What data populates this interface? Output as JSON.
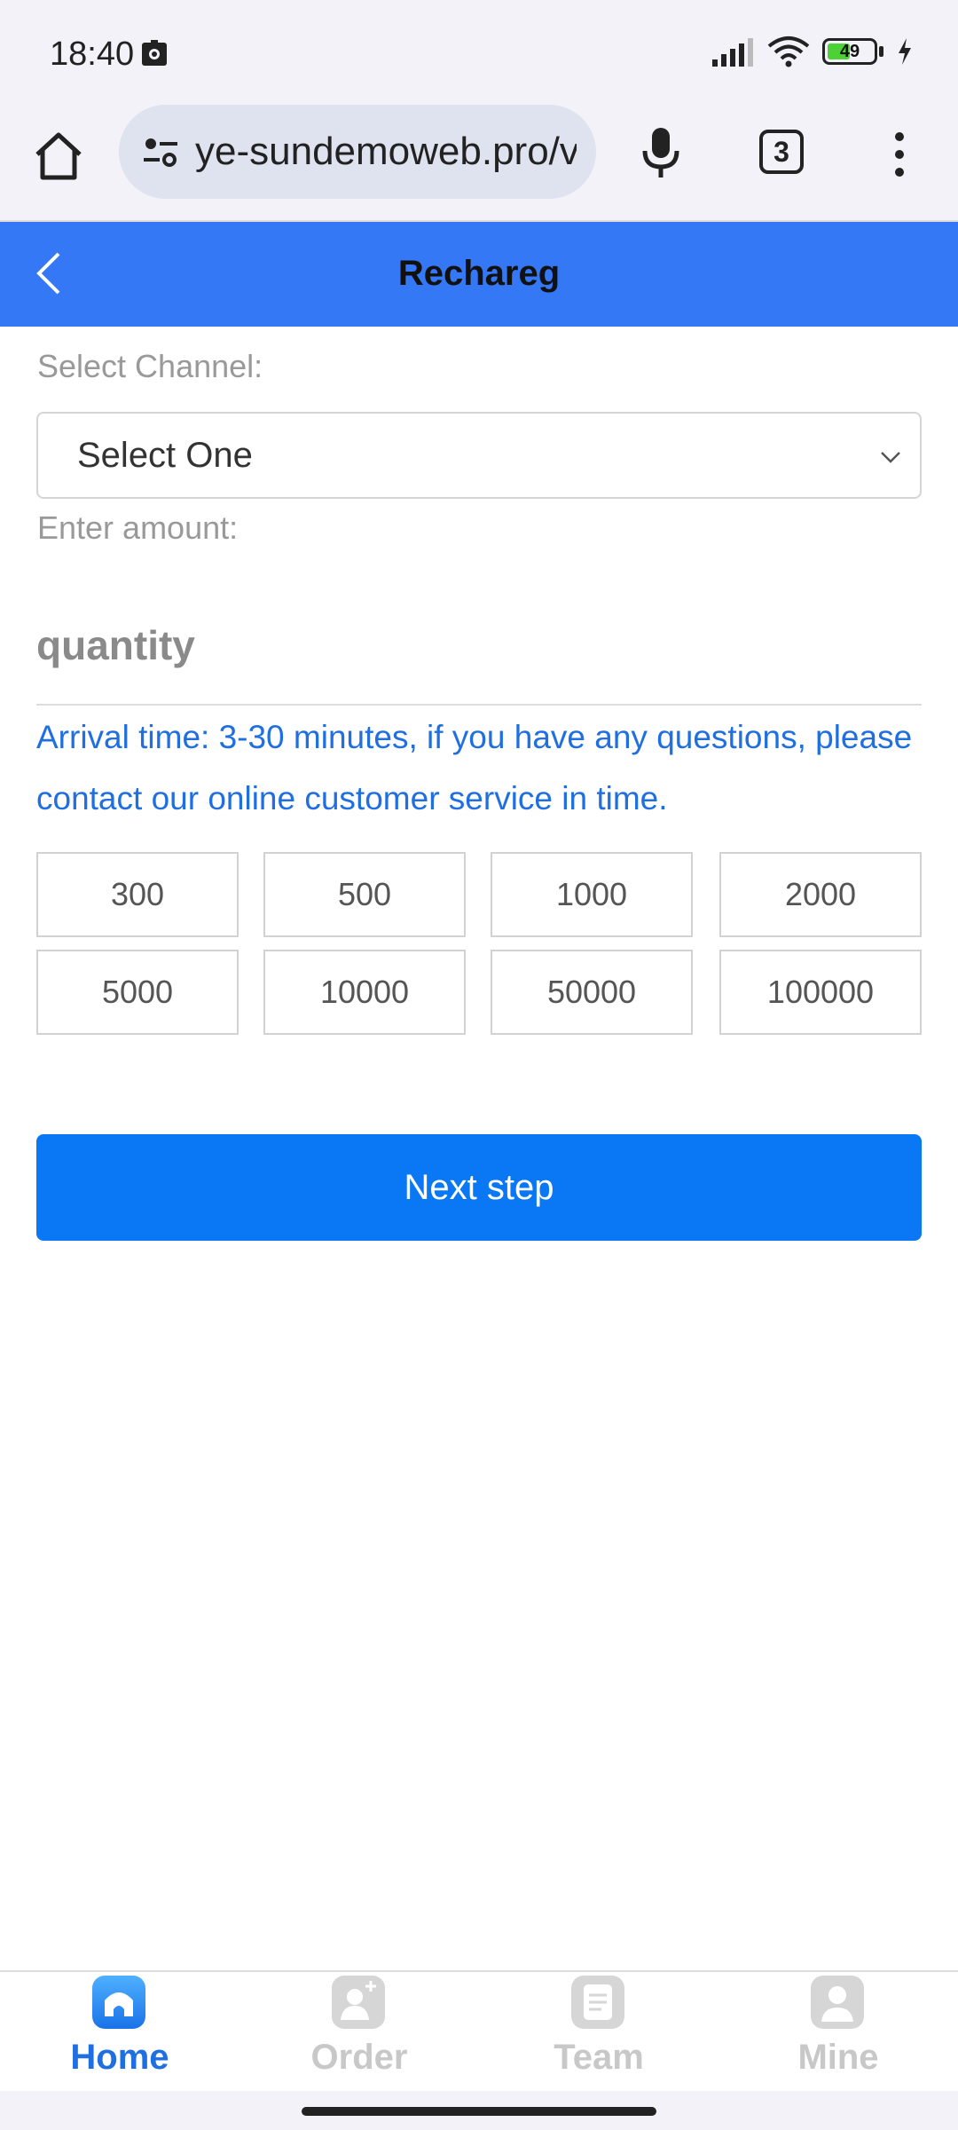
{
  "status_bar": {
    "time": "18:40",
    "battery_level": "49",
    "battery_fill_fraction": 0.49
  },
  "browser": {
    "url": "ye-sundemoweb.pro/v",
    "tab_count": "3"
  },
  "header": {
    "title": "Rechareg"
  },
  "form": {
    "channel_label": "Select Channel:",
    "channel_selected": "Select One",
    "amount_label": "Enter amount:",
    "amount_placeholder": "quantity",
    "amount_value": "",
    "notice": "Arrival time: 3-30 minutes, if you have any questions, please contact our online customer service in time.",
    "quick_amounts": [
      "300",
      "500",
      "1000",
      "2000",
      "5000",
      "10000",
      "50000",
      "100000"
    ],
    "next_button": "Next step"
  },
  "bottom_nav": {
    "items": [
      {
        "label": "Home",
        "icon": "home-icon",
        "active": true
      },
      {
        "label": "Order",
        "icon": "order-icon",
        "active": false
      },
      {
        "label": "Team",
        "icon": "team-icon",
        "active": false
      },
      {
        "label": "Mine",
        "icon": "mine-icon",
        "active": false
      }
    ]
  },
  "colors": {
    "primary": "#3478f6",
    "button": "#0a78f5",
    "notice": "#1f6fe0",
    "inactive": "#c8c8c8"
  }
}
